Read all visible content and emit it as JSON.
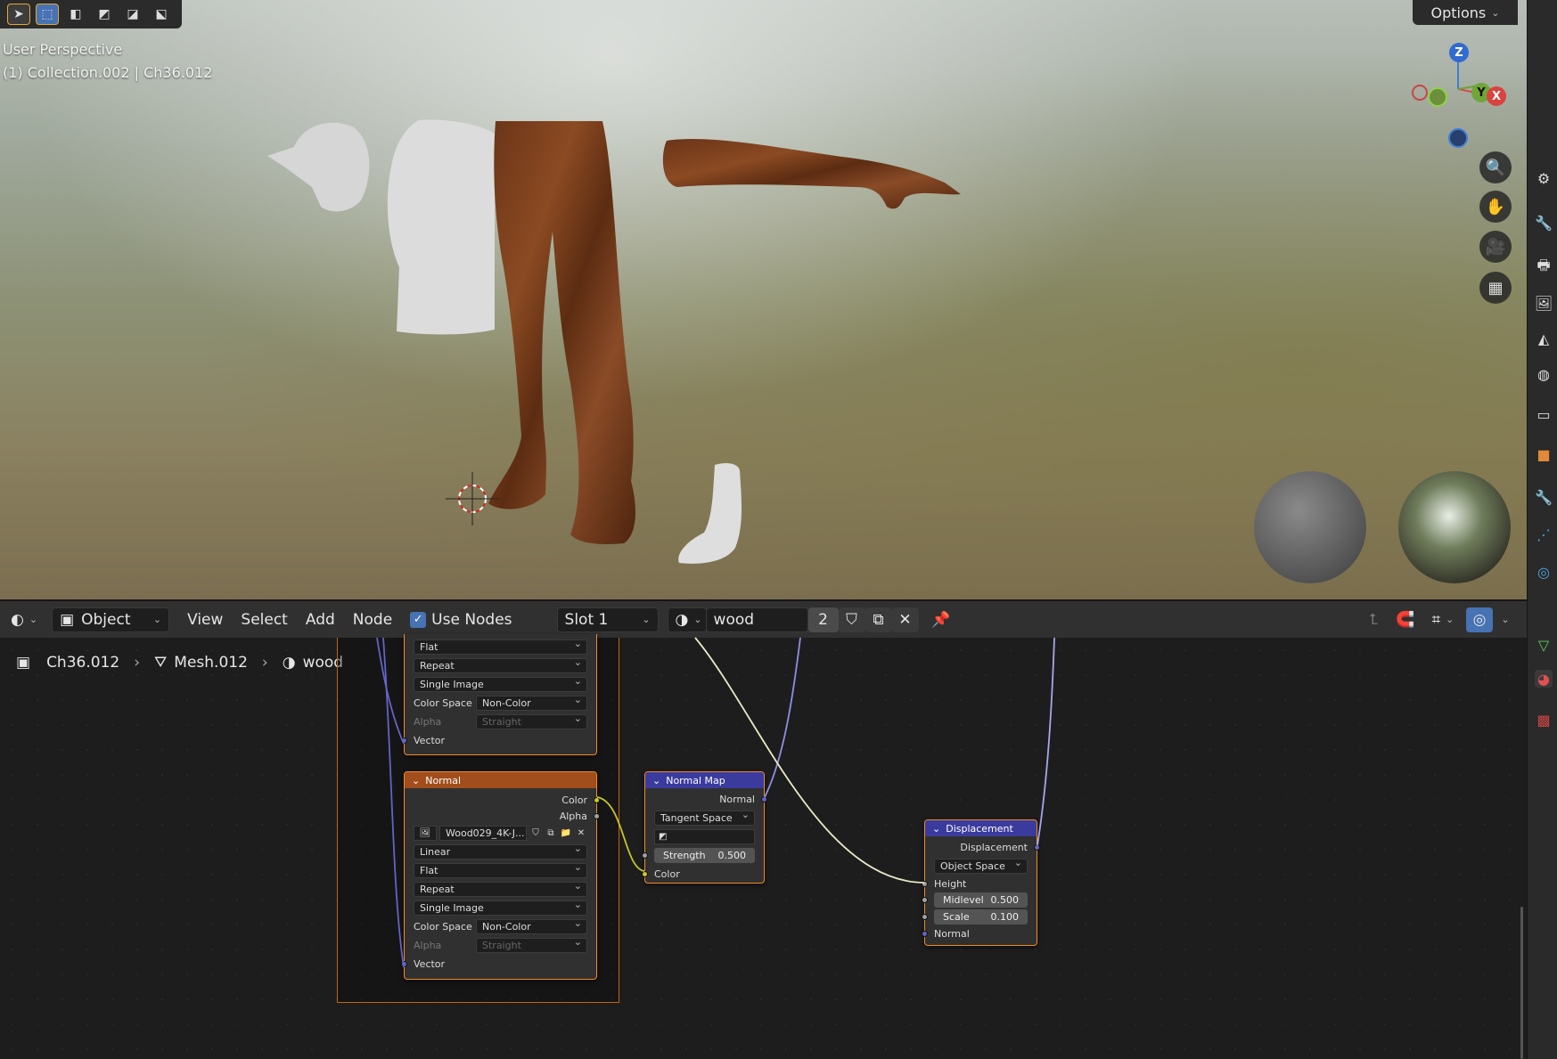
{
  "viewport": {
    "perspective_label": "User Perspective",
    "collection_label": "(1) Collection.002 | Ch36.012",
    "options_label": "Options",
    "axes": {
      "z": "Z",
      "y": "Y",
      "x": "X"
    }
  },
  "header": {
    "mode_label": "Object",
    "menus": [
      "View",
      "Select",
      "Add",
      "Node"
    ],
    "use_nodes_label": "Use Nodes",
    "slot_label": "Slot 1",
    "material_name": "wood",
    "user_count": "2"
  },
  "breadcrumb": {
    "object": "Ch36.012",
    "mesh": "Mesh.012",
    "material": "wood"
  },
  "nodes": {
    "top_image": {
      "interp": "Flat",
      "extension": "Repeat",
      "source": "Single Image",
      "colorspace_label": "Color Space",
      "colorspace": "Non-Color",
      "alpha_label": "Alpha",
      "alpha": "Straight",
      "vector": "Vector"
    },
    "normal_image": {
      "title": "Normal",
      "out_color": "Color",
      "out_alpha": "Alpha",
      "image_name": "Wood029_4K-J...",
      "interpolation": "Linear",
      "projection": "Flat",
      "extension": "Repeat",
      "source": "Single Image",
      "colorspace_label": "Color Space",
      "colorspace": "Non-Color",
      "alpha_label": "Alpha",
      "alpha": "Straight",
      "vector": "Vector"
    },
    "normal_map": {
      "title": "Normal Map",
      "out_normal": "Normal",
      "space": "Tangent Space",
      "strength_label": "Strength",
      "strength_value": "0.500",
      "in_color": "Color"
    },
    "displacement": {
      "title": "Displacement",
      "out_disp": "Displacement",
      "space": "Object Space",
      "height": "Height",
      "midlevel_label": "Midlevel",
      "midlevel_value": "0.500",
      "scale_label": "Scale",
      "scale_value": "0.100",
      "normal": "Normal"
    }
  },
  "colors": {
    "accent": "#4772b3",
    "node_border": "#f08a2a",
    "normal_header": "#a14d1c",
    "vector_header": "#3b3b9e"
  }
}
